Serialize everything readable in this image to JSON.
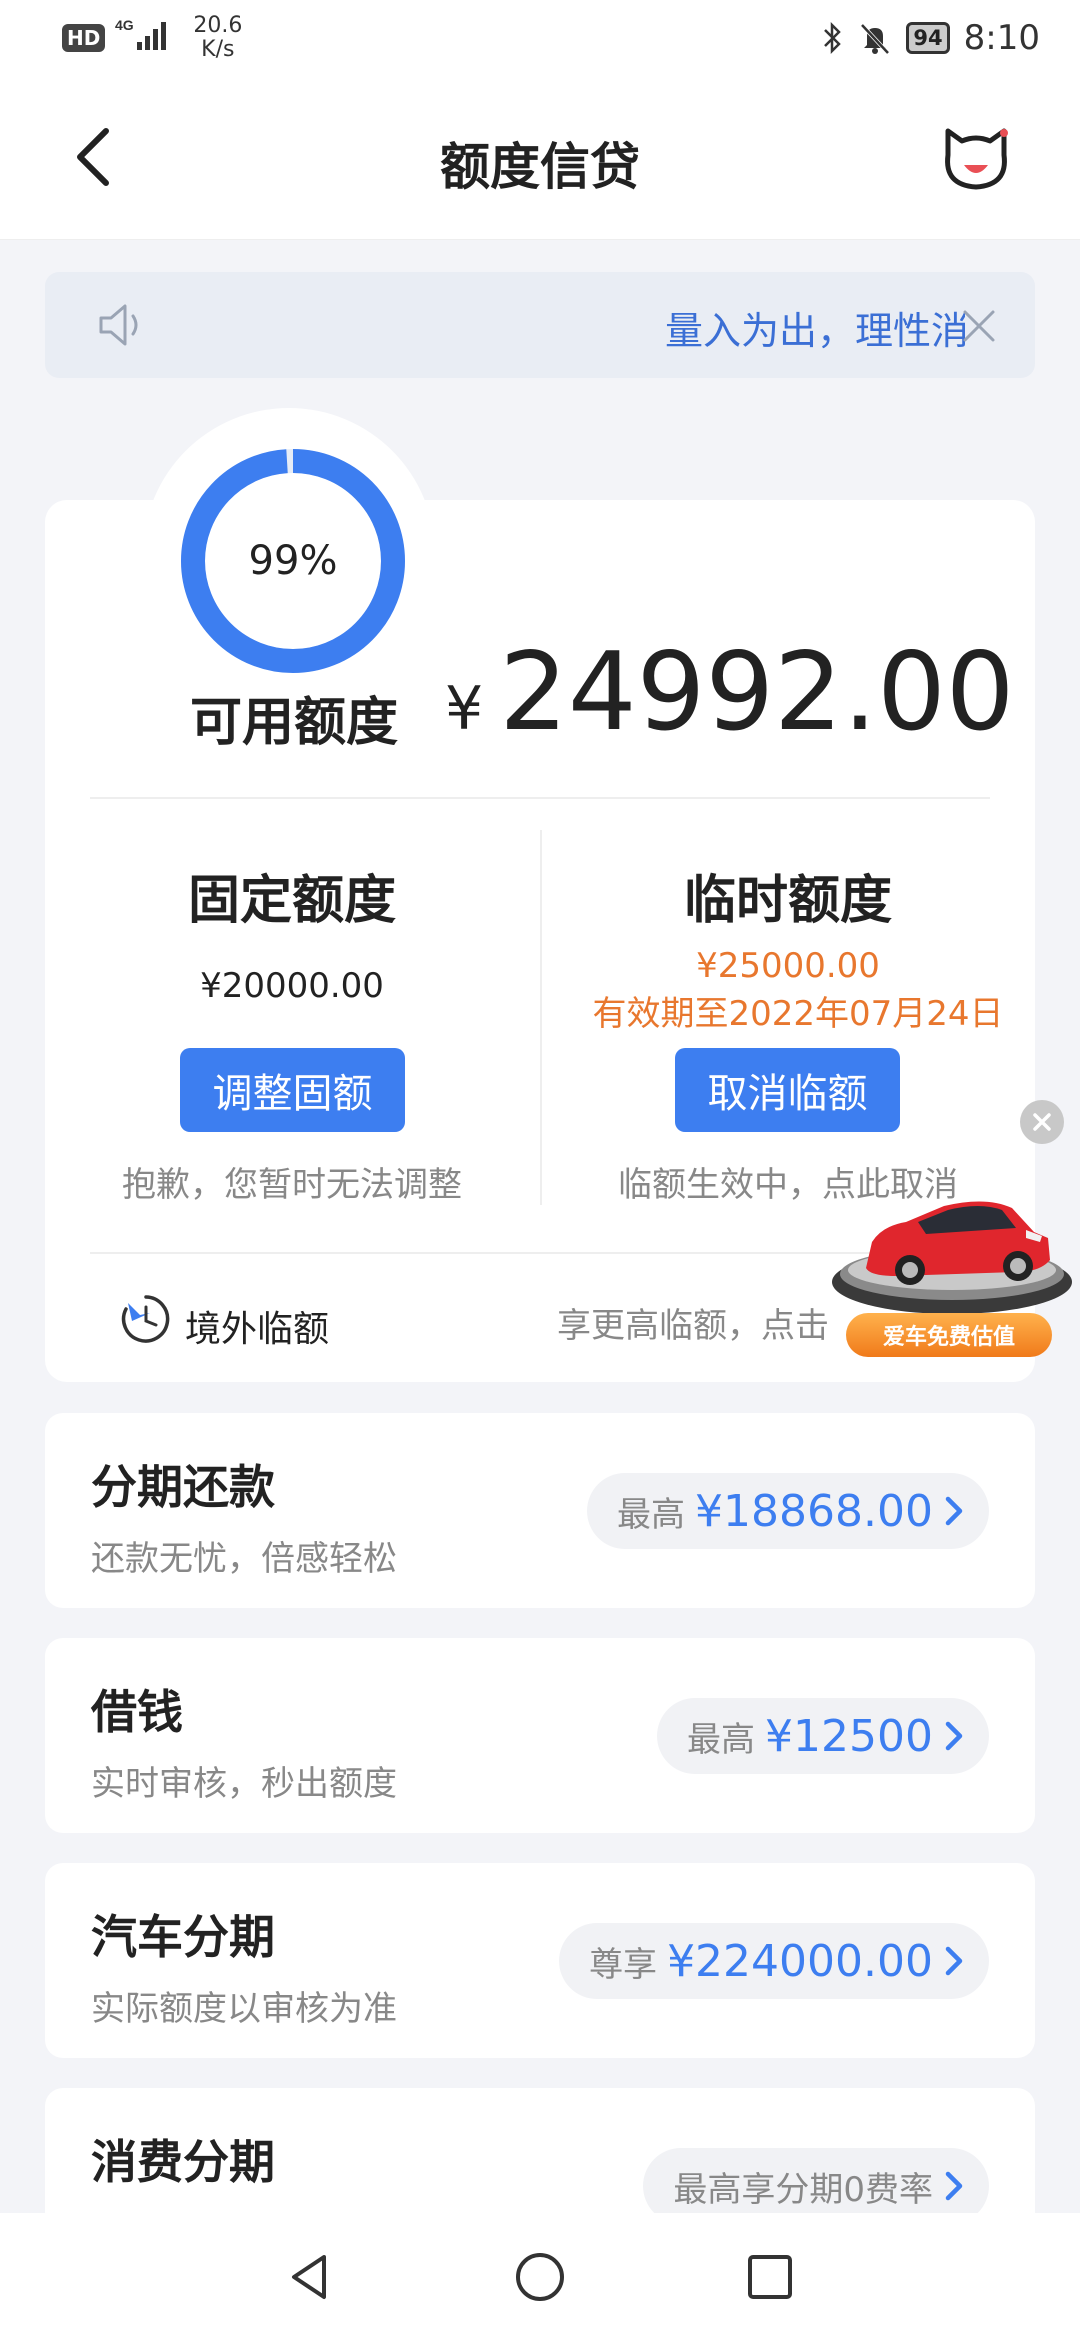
{
  "status_bar": {
    "hd": "HD",
    "network": "4G",
    "speed_value": "20.6",
    "speed_unit": "K/s",
    "battery": "94",
    "time": "8:10"
  },
  "header": {
    "title": "额度信贷"
  },
  "notice": {
    "text": "量入为出，理性消费"
  },
  "credit": {
    "percent_label": "99%",
    "percent_value": 0.99,
    "available_label": "可用额度",
    "currency": "¥",
    "available_amount": "24992.00",
    "fixed": {
      "title": "固定额度",
      "amount": "¥20000.00",
      "button": "调整固额",
      "note": "抱歉，您暂时无法调整"
    },
    "temp": {
      "title": "临时额度",
      "amount": "¥25000.00",
      "validity": "有效期至2022年07月24日",
      "button": "取消临额",
      "note": "临额生效中，点此取消"
    },
    "overseas": {
      "label": "境外临额",
      "hint": "享更高临额，点击"
    }
  },
  "promo": {
    "label": "爱车免费估值"
  },
  "products": [
    {
      "name": "分期还款",
      "desc": "还款无忧，倍感轻松",
      "prefix": "最高",
      "amount": "¥18868.00"
    },
    {
      "name": "借钱",
      "desc": "实时审核，秒出额度",
      "prefix": "最高",
      "amount": "¥12500"
    },
    {
      "name": "汽车分期",
      "desc": "实际额度以审核为准",
      "prefix": "尊享",
      "amount": "¥224000.00"
    },
    {
      "name": "消费分期",
      "desc": "",
      "prefix": "最高享分期0费率",
      "amount": ""
    }
  ],
  "colors": {
    "accent": "#3d7ef0",
    "link": "#3b6fd5",
    "warning": "#e8772e",
    "muted": "#888888"
  }
}
